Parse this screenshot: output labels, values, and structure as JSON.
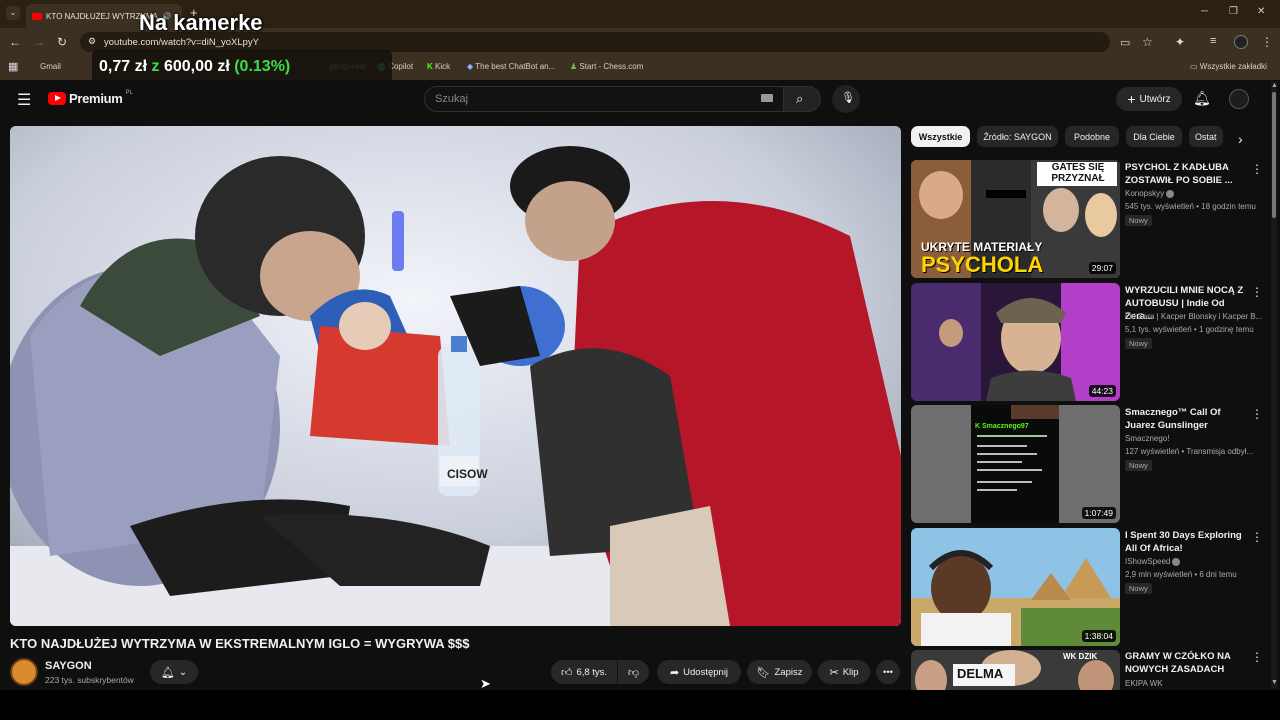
{
  "browser": {
    "tab_title": "KTO NAJDŁUŻEJ WYTRZYMA",
    "url": "youtube.com/watch?v=diN_yoXLpyY",
    "bookmarks": [
      "Gmail",
      "geoguessr",
      "Copilot",
      "Kick",
      "The best ChatBot an...",
      "Start - Chess.com"
    ],
    "all_bookmarks": "Wszystkie zakładki"
  },
  "overlay": {
    "title": "Na kamerke",
    "price_a": "0,77 zł",
    "sep": "z",
    "price_b": "600,00 zł",
    "pct": "(0.13%)"
  },
  "youtube": {
    "logo": "Premium",
    "logo_sup": "PL",
    "search_placeholder": "Szukaj",
    "create_label": "Utwórz"
  },
  "video": {
    "title": "KTO NAJDŁUŻEJ WYTRZYMA W EKSTREMALNYM IGLO = WYGRYWA $$$",
    "channel": "SAYGON",
    "subscribers": "223 tys. subskrybentów",
    "likes": "6,8 tys.",
    "share_label": "Udostępnij",
    "save_label": "Zapisz",
    "clip_label": "Klip",
    "bottle_label": "CISOW"
  },
  "chips": [
    "Wszystkie",
    "Źródło: SAYGON",
    "Podobne",
    "Dla Ciebie",
    "Ostat"
  ],
  "recommendations": [
    {
      "title": "PSYCHOL Z KADŁUBA ZOSTAWIŁ PO SOBIE ...",
      "channel": "Konopskyy",
      "verified": true,
      "meta": "545 tys. wyświetleń • 18 godzin temu",
      "badge": "Nowy",
      "duration": "29:07",
      "thumb_top": "GATES SIĘ PRZYZNAŁ",
      "thumb_bottom_1": "UKRYTE MATERIAŁY",
      "thumb_bottom_2": "PSYCHOLA"
    },
    {
      "title": "WYRZUCILI MNIE NOCĄ Z AUTOBUSU | Indie Od Zera...",
      "channel": "Od Zera | Kacper Blonsky i Kacper B...",
      "verified": false,
      "meta": "5,1 tys. wyświetleń • 1 godzinę temu",
      "badge": "Nowy",
      "duration": "44:23"
    },
    {
      "title": "Smacznego™ Call Of Juarez Gunslinger",
      "channel": "Smacznego!",
      "verified": false,
      "meta": "127 wyświetleń • Transmisja odbył...",
      "badge": "Nowy",
      "duration": "1:07:49",
      "thumb_tag": "K Smacznego97"
    },
    {
      "title": "I Spent 30 Days Exploring All Of Africa!",
      "channel": "IShowSpeed",
      "verified": true,
      "meta": "2,9 mln wyświetleń • 6 dni temu",
      "badge": "Nowy",
      "duration": "1:38:04"
    },
    {
      "title": "GRAMY W CZÓŁKO NA NOWYCH ZASADACH",
      "channel": "EKIPA WK",
      "verified": false,
      "meta": "",
      "badge": "",
      "duration": "",
      "thumb_tag": "DELMA",
      "thumb_logo": "WK DZIK"
    }
  ]
}
